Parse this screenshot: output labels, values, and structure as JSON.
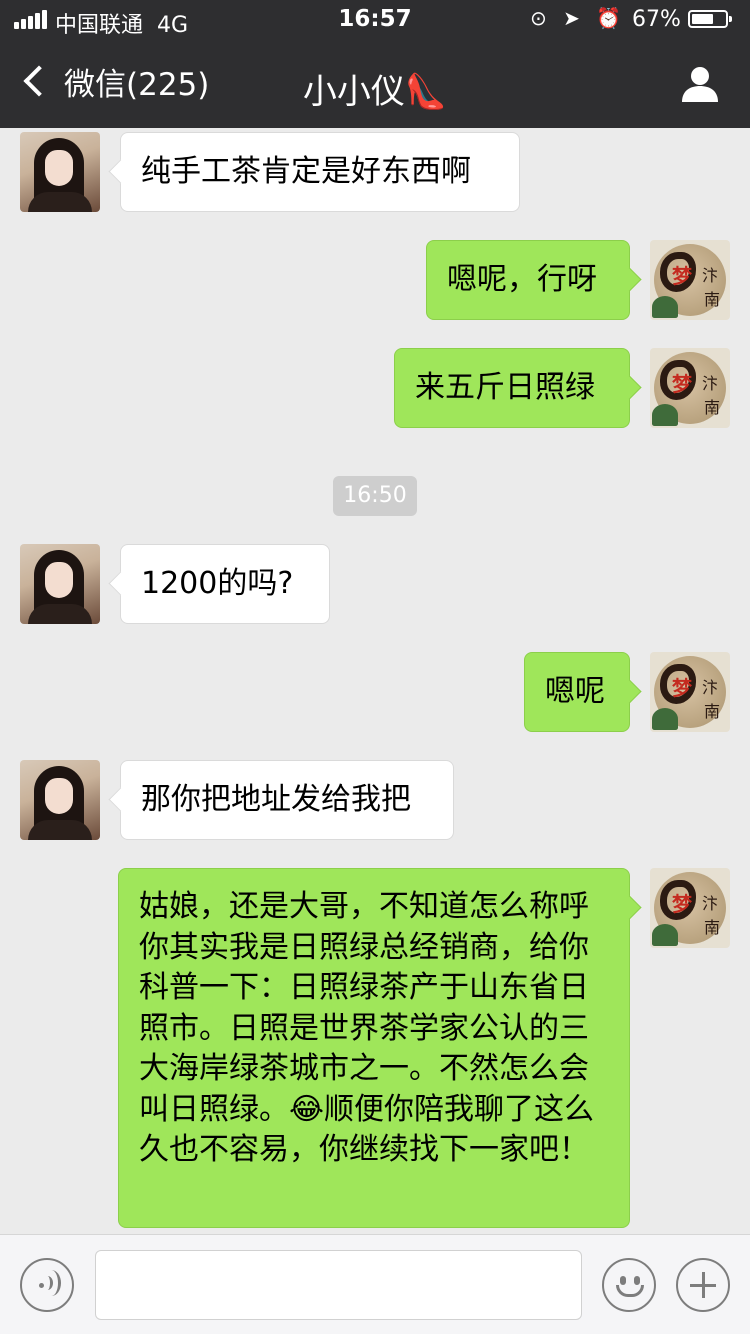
{
  "status_bar": {
    "carrier": "中国联通",
    "network": "4G",
    "time": "16:57",
    "battery_percent": "67%",
    "battery_level": 0.67
  },
  "nav": {
    "back_label": "微信(225)",
    "title": "小小仪",
    "title_emoji": "👠"
  },
  "chat": {
    "messages": [
      {
        "sender": "friend",
        "text": "纯手工茶肯定是好东西啊"
      },
      {
        "sender": "me",
        "text": "嗯呢，行呀"
      },
      {
        "sender": "me",
        "text": "来五斤日照绿"
      },
      {
        "type": "timestamp",
        "text": "16:50"
      },
      {
        "sender": "friend",
        "text": "1200的吗?"
      },
      {
        "sender": "me",
        "text": "嗯呢"
      },
      {
        "sender": "friend",
        "text": "那你把地址发给我把"
      },
      {
        "sender": "me",
        "text": "姑娘，还是大哥，不知道怎么称呼你其实我是日照绿总经销商，给你科普一下：日照绿茶产于山东省日照市。日照是世界茶学家公认的三大海岸绿茶城市之一。不然怎么会叫日照绿。😂顺便你陪我聊了这么久也不容易，你继续找下一家吧！"
      }
    ],
    "my_avatar_chars": [
      "梦",
      "汴",
      "南"
    ]
  },
  "input_bar": {
    "icons": [
      "voice-icon",
      "emoji-icon",
      "plus-icon"
    ]
  }
}
